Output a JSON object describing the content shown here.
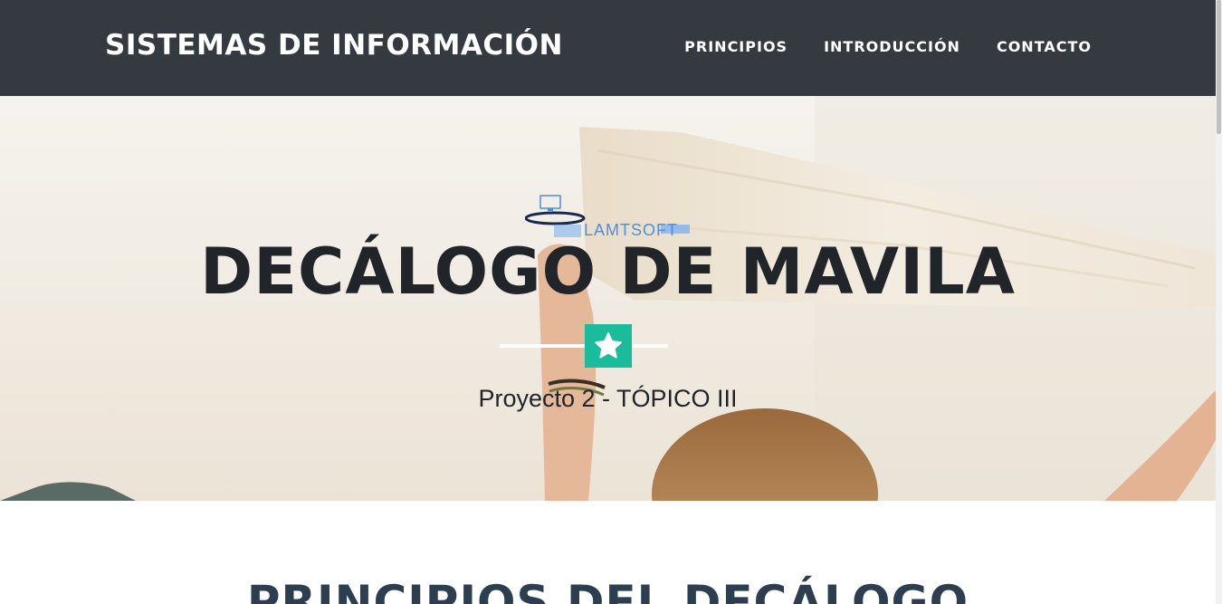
{
  "navbar": {
    "brand": "SISTEMAS DE INFORMACIÓN",
    "links": [
      {
        "label": "PRINCIPIOS"
      },
      {
        "label": "INTRODUCCIÓN"
      },
      {
        "label": "CONTACTO"
      }
    ],
    "background": "#343a40"
  },
  "hero": {
    "logo_text": "LAMTSOFT",
    "title": "DECÁLOGO DE MAVILA",
    "divider_icon": "star-icon",
    "subtitle": "Proyecto 2 - TÓPICO III",
    "accent_color": "#1abc9c"
  },
  "section": {
    "title": "PRINCIPIOS DEL DECÁLOGO"
  }
}
